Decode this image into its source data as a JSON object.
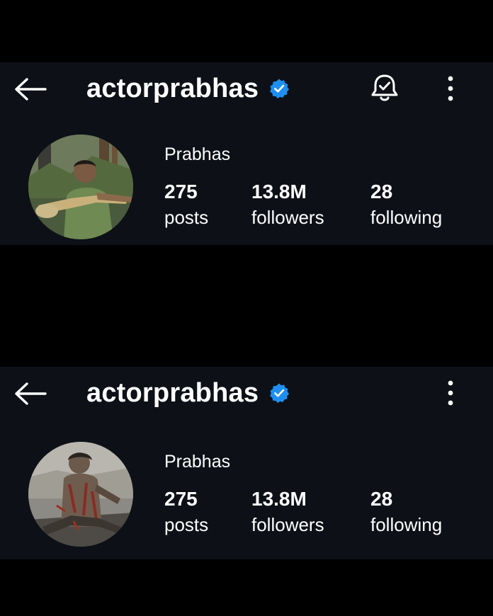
{
  "profiles": [
    {
      "header": {
        "back_icon": "arrow-left-icon",
        "handle": "actorprabhas",
        "verified_icon": "verified-badge-icon",
        "notification_icon": "bell-check-icon",
        "menu_icon": "more-vertical-icon"
      },
      "avatar_icon": "profile-photo",
      "name": "Prabhas",
      "stats": [
        {
          "value": "275",
          "label": "posts"
        },
        {
          "value": "13.8M",
          "label": "followers"
        },
        {
          "value": "28",
          "label": "following"
        }
      ]
    },
    {
      "header": {
        "back_icon": "arrow-left-icon",
        "handle": "actorprabhas",
        "verified_icon": "verified-badge-icon",
        "menu_icon": "more-vertical-icon"
      },
      "avatar_icon": "profile-photo",
      "name": "Prabhas",
      "stats": [
        {
          "value": "275",
          "label": "posts"
        },
        {
          "value": "13.8M",
          "label": "followers"
        },
        {
          "value": "28",
          "label": "following"
        }
      ]
    }
  ],
  "colors": {
    "page_background": "#000000",
    "panel_background": "#0d1117",
    "text": "#ffffff",
    "verified_blue": "#1f8ef1"
  }
}
